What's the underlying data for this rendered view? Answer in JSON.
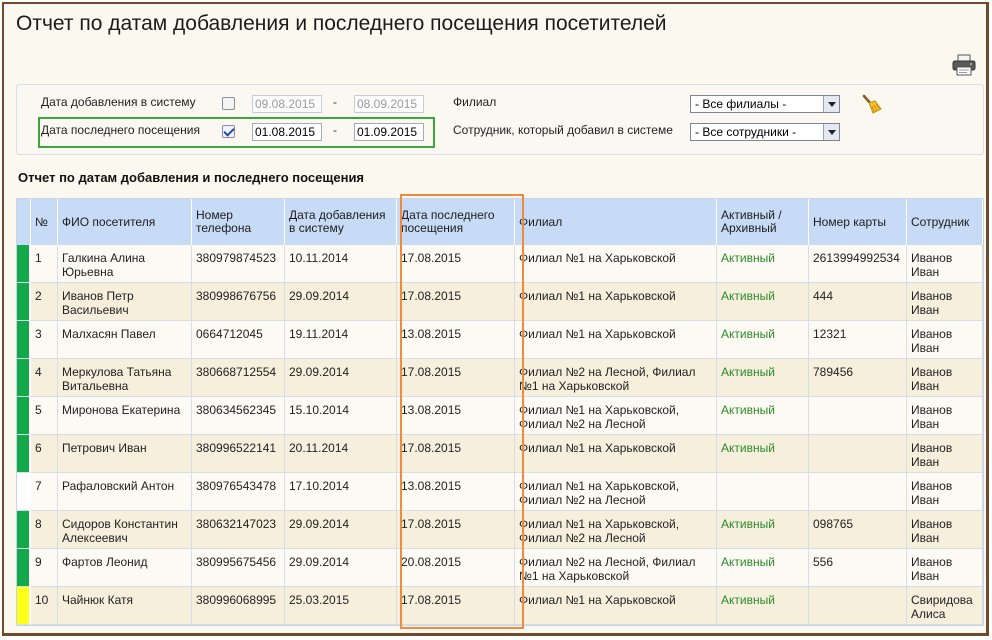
{
  "page_title": "Отчет по датам добавления и последнего посещения посетителей",
  "filters": {
    "date_added_label": "Дата добавления в систему",
    "date_added_from": "09.08.2015",
    "date_added_to": "08.09.2015",
    "last_visit_label": "Дата последнего посещения",
    "last_visit_from": "01.08.2015",
    "last_visit_to": "01.09.2015",
    "dash": "-",
    "branch_label": "Филиал",
    "branch_value": "- Все филиалы -",
    "employee_label": "Сотрудник, который добавил в системе",
    "employee_value": "- Все сотрудники -"
  },
  "section_title": "Отчет по датам добавления и последнего посещения",
  "table": {
    "headers": {
      "num": "№",
      "name": "ФИО посетителя",
      "phone": "Номер телефона",
      "added": "Дата добавления в систему",
      "last": "Дата последнего посещения",
      "branch": "Филиал",
      "status": "Активный / Архивный",
      "card": "Номер карты",
      "employee": "Сотрудник"
    },
    "rows": [
      {
        "num": "1",
        "name": "Галкина Алина Юрьевна",
        "phone": "380979874523",
        "added": "10.11.2014",
        "last": "17.08.2015",
        "branch": "Филиал №1 на Харьковской",
        "status": "Активный",
        "card": "2613994992534",
        "employee": "Иванов Иван"
      },
      {
        "num": "2",
        "name": "Иванов Петр Васильевич",
        "phone": "380998676756",
        "added": "29.09.2014",
        "last": "17.08.2015",
        "branch": "Филиал №1 на Харьковской",
        "status": "Активный",
        "card": "444",
        "employee": "Иванов Иван"
      },
      {
        "num": "3",
        "name": "Малхасян Павел",
        "phone": "0664712045",
        "added": "19.11.2014",
        "last": "13.08.2015",
        "branch": "Филиал №1 на Харьковской",
        "status": "Активный",
        "card": "12321",
        "employee": "Иванов Иван"
      },
      {
        "num": "4",
        "name": "Меркулова Татьяна Витальевна",
        "phone": "380668712554",
        "added": "29.09.2014",
        "last": "17.08.2015",
        "branch": "Филиал №2 на Лесной, Филиал №1 на Харьковской",
        "status": "Активный",
        "card": "789456",
        "employee": "Иванов Иван"
      },
      {
        "num": "5",
        "name": "Миронова Екатерина",
        "phone": "380634562345",
        "added": "15.10.2014",
        "last": "13.08.2015",
        "branch": "Филиал №1 на Харьковской, Филиал №2 на Лесной",
        "status": "Активный",
        "card": "",
        "employee": "Иванов Иван"
      },
      {
        "num": "6",
        "name": "Петрович Иван",
        "phone": "380996522141",
        "added": "20.11.2014",
        "last": "17.08.2015",
        "branch": "Филиал №1 на Харьковской",
        "status": "Активный",
        "card": "",
        "employee": "Иванов Иван"
      },
      {
        "num": "7",
        "name": "Рафаловский Антон",
        "phone": "380976543478",
        "added": "17.10.2014",
        "last": "13.08.2015",
        "branch": "Филиал №1 на Харьковской, Филиал №2 на Лесной",
        "status": "",
        "card": "",
        "employee": "Иванов Иван"
      },
      {
        "num": "8",
        "name": "Сидоров Константин Алексеевич",
        "phone": "380632147023",
        "added": "29.09.2014",
        "last": "17.08.2015",
        "branch": "Филиал №1 на Харьковской, Филиал №2 на Лесной",
        "status": "Активный",
        "card": "098765",
        "employee": "Иванов Иван"
      },
      {
        "num": "9",
        "name": "Фартов Леонид",
        "phone": "380995675456",
        "added": "29.09.2014",
        "last": "20.08.2015",
        "branch": "Филиал №2 на Лесной, Филиал №1 на Харьковской",
        "status": "Активный",
        "card": "556",
        "employee": "Иванов Иван"
      },
      {
        "num": "10",
        "name": "Чайнюк Катя",
        "phone": "380996068995",
        "added": "25.03.2015",
        "last": "17.08.2015",
        "branch": "Филиал №1 на Харьковской",
        "status": "Активный",
        "card": "",
        "employee": "Свиридова Алиса"
      }
    ]
  },
  "colors": {
    "marker_active": "#13a84a",
    "marker_yellow": "#ffff1a",
    "highlight_filter": "#3ea63e",
    "highlight_column": "#f08a3c",
    "header_bg": "#c8dbf6"
  }
}
